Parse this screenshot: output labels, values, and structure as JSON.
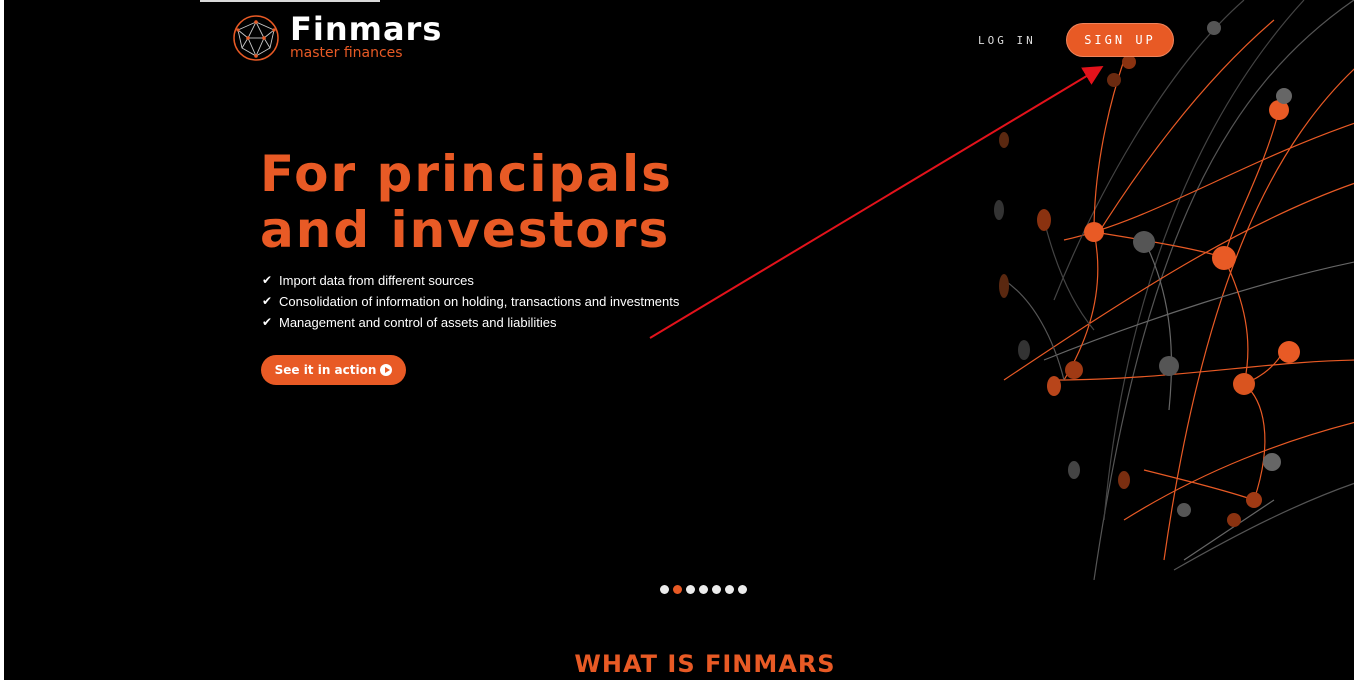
{
  "header": {
    "brand_name": "Finmars",
    "brand_tagline": "master finances",
    "login_label": "LOG IN",
    "signup_label": "SIGN UP"
  },
  "hero": {
    "title_line1": "For principals",
    "title_line2": "and investors",
    "features": [
      "Import data from different sources",
      "Consolidation of information on holding, transactions and investments",
      "Management and control of assets and liabilities"
    ],
    "cta_label": "See it in action"
  },
  "carousel": {
    "total": 7,
    "active_index": 1
  },
  "section": {
    "title": "WHAT IS FINMARS"
  },
  "colors": {
    "accent": "#e85a25",
    "background": "#000000",
    "annotation": "#e3121b"
  },
  "icons": {
    "check": "check-icon",
    "play": "play-circle-icon",
    "logo": "globe-network-logo"
  }
}
